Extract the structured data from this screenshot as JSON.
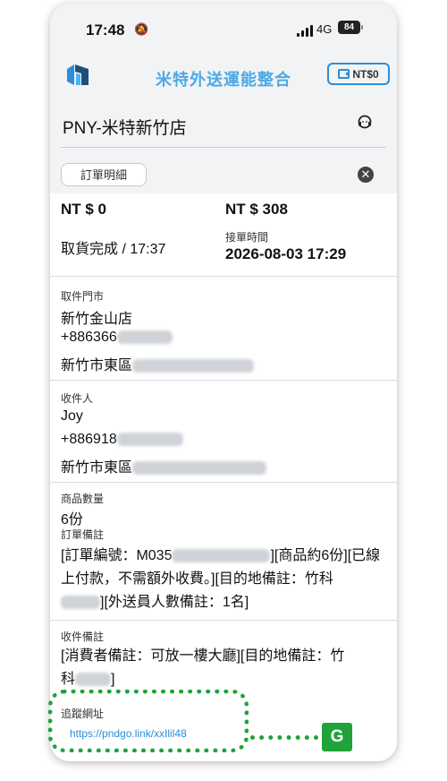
{
  "status_bar": {
    "time": "17:48",
    "network": "4G",
    "battery": "84"
  },
  "app": {
    "title": "米特外送運能整合",
    "wallet_label": "NT$0"
  },
  "store": {
    "name": "PNY-米特新竹店"
  },
  "tabs": {
    "order_detail": "訂單明細"
  },
  "order": {
    "amount_left": "NT $ 0",
    "amount_right": "NT $ 308",
    "status": "取貨完成 / 17:37",
    "accept_time_label": "接單時間",
    "accept_time": "2026-08-03 17:29"
  },
  "pickup": {
    "label": "取件門市",
    "store": "新竹金山店",
    "phone": "+886366",
    "address": "新竹市東區"
  },
  "recipient": {
    "label": "收件人",
    "name": "Joy",
    "phone": "+886918",
    "address": "新竹市東區"
  },
  "items": {
    "label": "商品數量",
    "count": "6份"
  },
  "order_note": {
    "label": "訂單備註",
    "line1_prefix": "[訂單編號：M035",
    "line1_suffix": "][商品約6份][已線",
    "line2": "上付款，不需額外收費。][目的地備註：竹科",
    "line3_suffix": "][外送員人數備註：1名]"
  },
  "recipient_note": {
    "label": "收件備註",
    "line1": "[消費者備註：可放一樓大廳][目的地備註：竹",
    "line2_prefix": "科",
    "line2_suffix": "]"
  },
  "tracking": {
    "label": "追蹤網址",
    "url": "https://pndgo.link/xxIlil48"
  },
  "annotation": {
    "badge": "G",
    "color": "#1fa33a"
  }
}
